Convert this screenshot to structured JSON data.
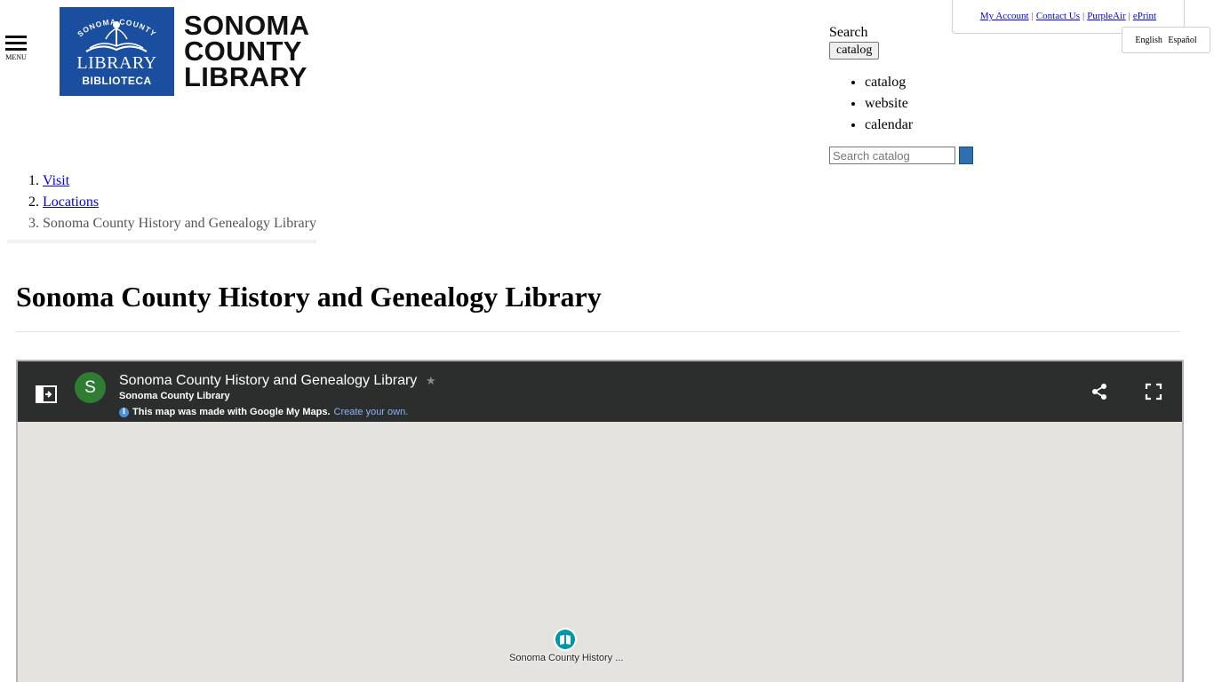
{
  "utility": {
    "links": [
      "My Account",
      "Contact Us",
      "PurpleAir",
      "ePrint"
    ],
    "languages": [
      "English",
      "Español"
    ]
  },
  "menu": {
    "label": "MENU"
  },
  "logo": {
    "tile_arc_text": "SONOMA COUNTY",
    "tile_line1": "LIBRARY",
    "tile_line2": "BIBLIOTECA",
    "brand_lines": [
      "SONOMA",
      "COUNTY",
      "LIBRARY"
    ]
  },
  "search": {
    "label": "Search",
    "scope_button": "catalog",
    "scopes": [
      "catalog",
      "website",
      "calendar"
    ],
    "placeholder": "Search catalog"
  },
  "breadcrumb": {
    "items": [
      "Visit",
      "Locations",
      "Sonoma County History and Genealogy Library"
    ]
  },
  "page": {
    "title": "Sonoma County History and Genealogy Library"
  },
  "map": {
    "avatar_letter": "S",
    "title": "Sonoma County History and Genealogy Library",
    "subtitle": "Sonoma County Library",
    "note_text": "This map was made with Google My Maps.",
    "note_link": "Create your own.",
    "pin_label": "Sonoma County History ...",
    "bar_color": "#2c2d2d",
    "background_color": "#e5e3df",
    "pin_color": "#0097a7"
  }
}
